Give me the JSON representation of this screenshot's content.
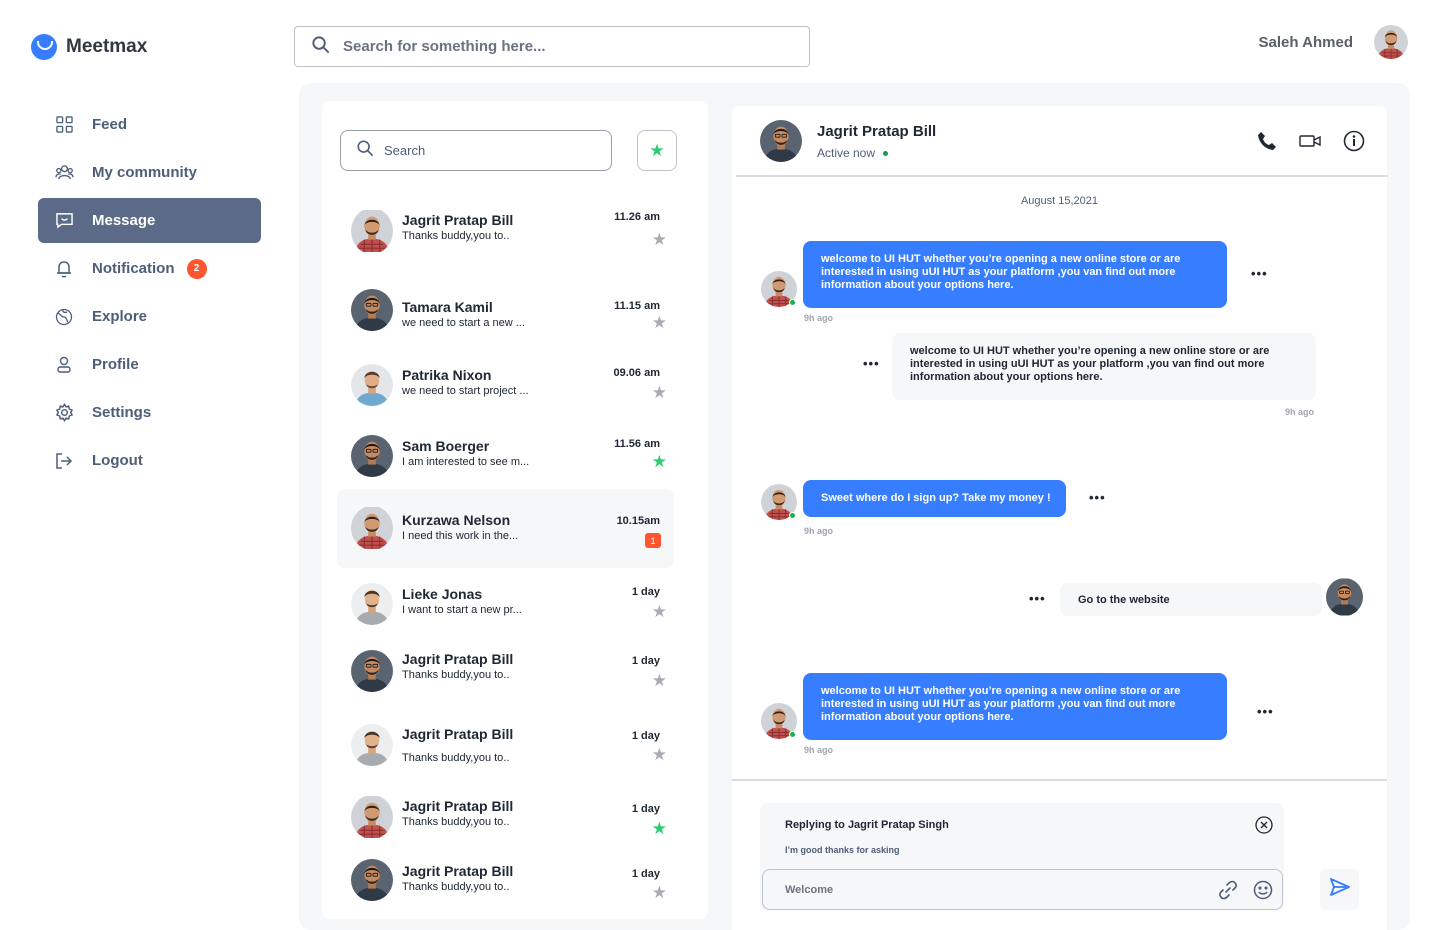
{
  "app": {
    "name": "Meetmax",
    "brand_color": "#377DFF"
  },
  "top_search": {
    "placeholder": "Search for something here..."
  },
  "user": {
    "name": "Saleh Ahmed"
  },
  "sidebar": {
    "items": [
      {
        "label": "Feed",
        "icon": "grid-icon"
      },
      {
        "label": "My community",
        "icon": "community-icon"
      },
      {
        "label": "Message",
        "icon": "message-icon",
        "active": true
      },
      {
        "label": "Notification",
        "icon": "bell-icon",
        "badge": "2"
      },
      {
        "label": "Explore",
        "icon": "globe-icon"
      },
      {
        "label": "Profile",
        "icon": "user-icon"
      },
      {
        "label": "Settings",
        "icon": "gear-icon"
      },
      {
        "label": "Logout",
        "icon": "logout-icon"
      }
    ]
  },
  "conversations": {
    "search_placeholder": "Search",
    "items": [
      {
        "name": "Jagrit Pratap Bill",
        "preview": "Thanks buddy,you to..",
        "time": "11.26 am",
        "starred": false
      },
      {
        "name": "Tamara Kamil",
        "preview": "we need to start a new ...",
        "time": "11.15 am",
        "starred": false
      },
      {
        "name": "Patrika Nixon",
        "preview": "we need to start project ...",
        "time": "09.06 am",
        "starred": false
      },
      {
        "name": "Sam Boerger",
        "preview": "I am interested to see m...",
        "time": "11.56 am",
        "starred": true
      },
      {
        "name": "Kurzawa Nelson",
        "preview": "I need this work in the...",
        "time": "10.15am",
        "unread": "1",
        "selected": true
      },
      {
        "name": "Lieke Jonas",
        "preview": "I want to start a new pr...",
        "time": "1 day",
        "starred": false
      },
      {
        "name": "Jagrit Pratap Bill",
        "preview": "Thanks buddy,you to..",
        "time": "1 day",
        "starred": false
      },
      {
        "name": "Jagrit Pratap Bill",
        "preview": "Thanks buddy,you to..",
        "time": "1 day",
        "starred": false
      },
      {
        "name": "Jagrit Pratap Bill",
        "preview": "Thanks buddy,you to..",
        "time": "1 day",
        "starred": true
      },
      {
        "name": "Jagrit Pratap Bill",
        "preview": "Thanks buddy,you to..",
        "time": "1 day",
        "starred": false
      }
    ]
  },
  "chat": {
    "name": "Jagrit Pratap Bill",
    "status": "Active now",
    "date": "August 15,2021",
    "messages": [
      {
        "text": "welcome to UI HUT  whether you’re opening a new online store or are interested in  using uUI HUT as your platform ,you van find out more information about your options  here.",
        "ago": "9h ago"
      },
      {
        "text": "welcome to UI HUT  whether you’re opening a new online store or are interested in  using uUI HUT as your platform ,you van find out more information about your options  here.",
        "ago": "9h ago"
      },
      {
        "text": "Sweet  where do I sign up? Take my money !",
        "ago": "9h ago"
      },
      {
        "text": "Go to the website"
      },
      {
        "text": "welcome to UI HUT  whether you’re opening a new online store or are interested in  using uUI HUT as your platform ,you van find out more information about your options  here.",
        "ago": "9h ago"
      }
    ],
    "reply": {
      "title": "Replying to Jagrit Pratap Singh",
      "text": "I’m good thanks for asking"
    },
    "input_placeholder": "Welcome"
  }
}
